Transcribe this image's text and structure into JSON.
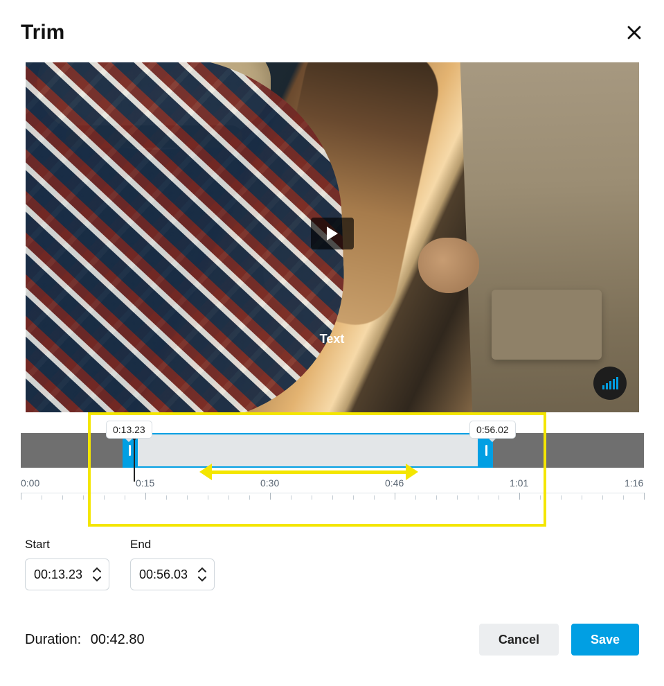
{
  "modal": {
    "title": "Trim",
    "overlay_text": "Text"
  },
  "timeline": {
    "tooltip_start": "0:13.23",
    "tooltip_end": "0:56.02",
    "ruler_labels": [
      "0:00",
      "0:15",
      "0:30",
      "0:46",
      "1:01",
      "1:16"
    ],
    "ruler_positions_pct": [
      0,
      20,
      40,
      60,
      80,
      100
    ]
  },
  "form": {
    "start_label": "Start",
    "start_value": "00:13.23",
    "end_label": "End",
    "end_value": "00:56.03"
  },
  "footer": {
    "duration_label": "Duration:",
    "duration_value": "00:42.80",
    "cancel": "Cancel",
    "save": "Save"
  },
  "colors": {
    "accent": "#019FE3",
    "highlight": "#f4e600"
  }
}
